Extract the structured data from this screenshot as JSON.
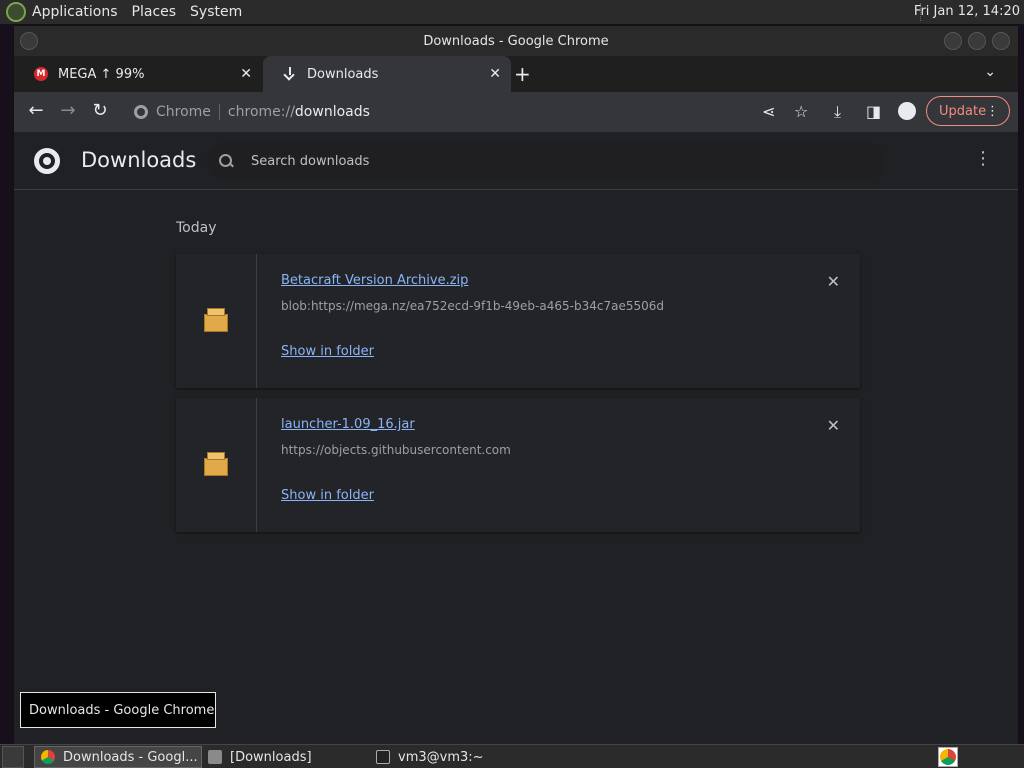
{
  "top_panel": {
    "menus": [
      "Applications",
      "Places",
      "System"
    ],
    "clock": "Fri Jan 12, 14:20"
  },
  "window": {
    "title": "Downloads - Google Chrome"
  },
  "tabs": [
    {
      "label": "MEGA ↑ 99%",
      "favicon": "mega-icon",
      "favicon_text": "M"
    },
    {
      "label": "Downloads",
      "favicon": "download-icon"
    }
  ],
  "toolbar": {
    "site_label": "Chrome",
    "url_scheme": "chrome://",
    "url_path": "downloads",
    "update_label": "Update"
  },
  "downloads_page": {
    "title": "Downloads",
    "search_placeholder": "Search downloads",
    "section_label": "Today",
    "items": [
      {
        "name": "Betacraft Version Archive.zip",
        "url": "blob:https://mega.nz/ea752ecd-9f1b-49eb-a465-b34c7ae5506d",
        "action": "Show in folder"
      },
      {
        "name": "launcher-1.09_16.jar",
        "url": "https://objects.githubusercontent.com",
        "action": "Show in folder"
      }
    ]
  },
  "tooltip": "Downloads - Google Chrome",
  "taskbar": {
    "tasks": [
      {
        "label": "Downloads - Googl...",
        "icon": "chrome-icon"
      },
      {
        "label": "[Downloads]",
        "icon": "folder-icon"
      },
      {
        "label": "vm3@vm3:~",
        "icon": "terminal-icon"
      }
    ]
  },
  "colors": {
    "accent_link": "#8ab4f8",
    "update": "#f28b82",
    "page_bg": "#202124"
  }
}
